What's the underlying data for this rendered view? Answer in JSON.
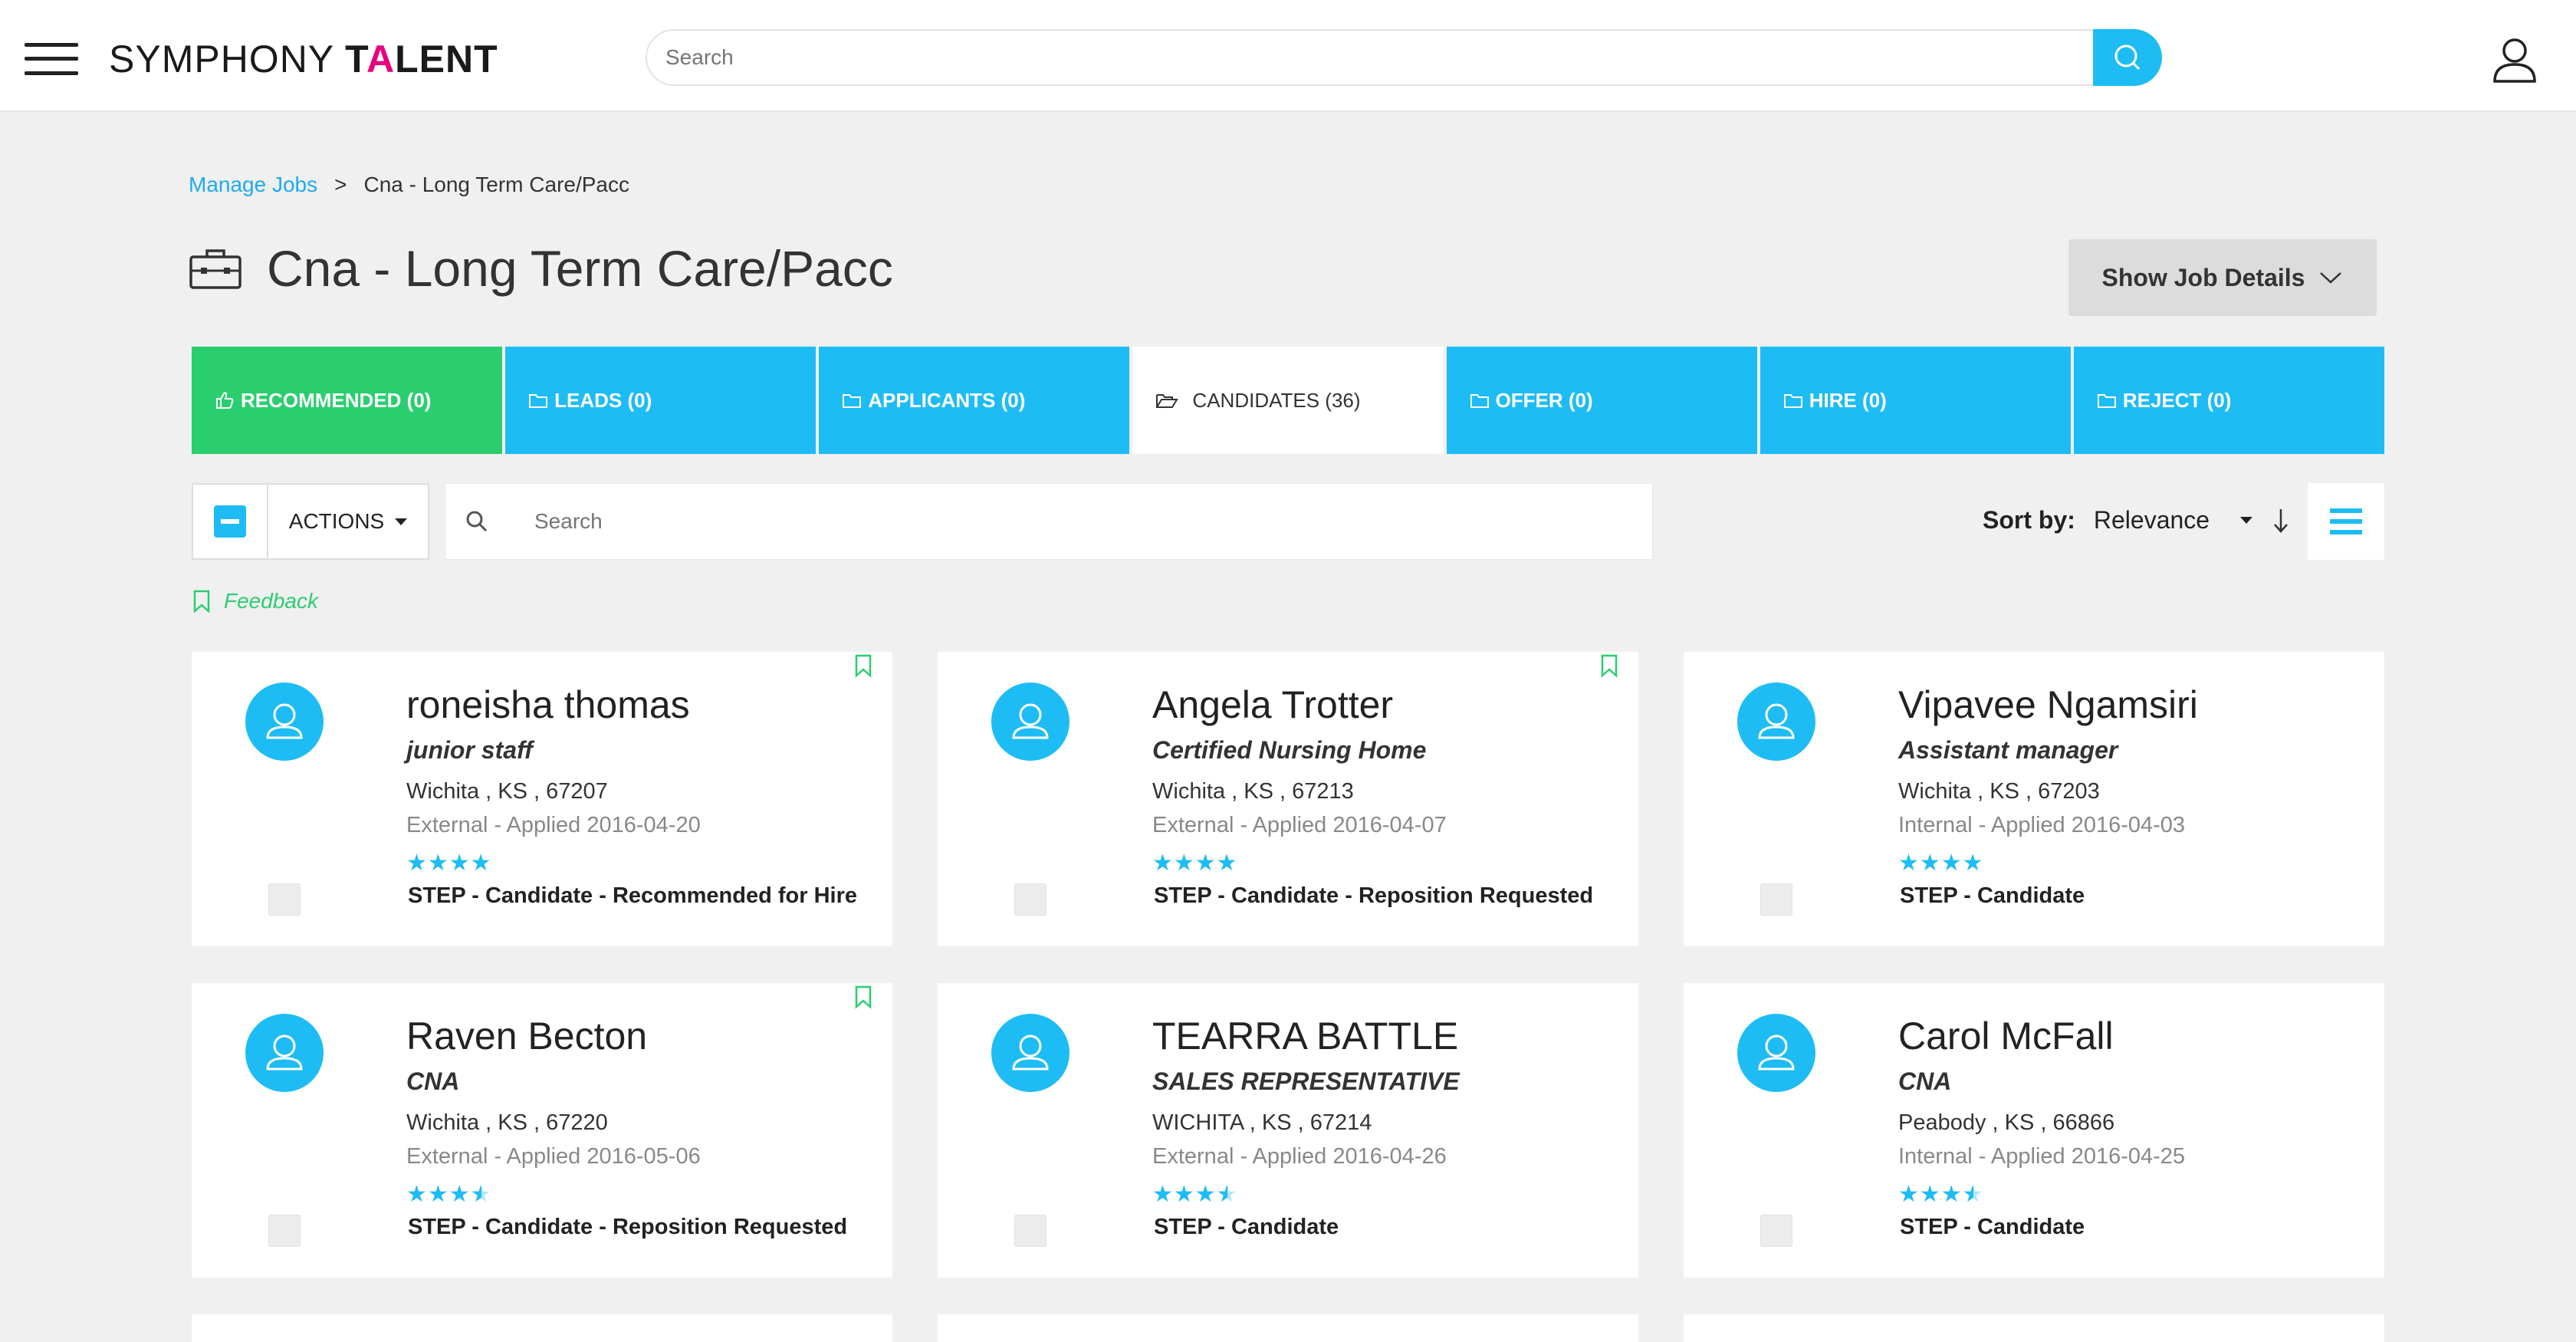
{
  "header": {
    "logo_part1": "SYMPHONY ",
    "logo_part2": "T",
    "logo_accent": "A",
    "logo_part3": "LENT",
    "search_placeholder": "Search"
  },
  "breadcrumb": {
    "root": "Manage Jobs",
    "separator": ">",
    "current": "Cna - Long Term Care/Pacc"
  },
  "page": {
    "title": "Cna - Long Term Care/Pacc",
    "show_details_label": "Show Job Details"
  },
  "tabs": [
    {
      "label": "RECOMMENDED (0)"
    },
    {
      "label": "LEADS (0)"
    },
    {
      "label": "APPLICANTS (0)"
    },
    {
      "label": "CANDIDATES (36)"
    },
    {
      "label": "OFFER (0)"
    },
    {
      "label": "HIRE (0)"
    },
    {
      "label": "REJECT (0)"
    }
  ],
  "toolbar": {
    "actions_label": "ACTIONS",
    "search_placeholder": "Search",
    "sort_label": "Sort by:",
    "sort_value": "Relevance"
  },
  "feedback_label": "Feedback",
  "candidates": [
    {
      "name": "roneisha thomas",
      "role": "junior staff",
      "location": "Wichita , KS , 67207",
      "applied": "External - Applied 2016-04-20",
      "rating": 4,
      "stars": "★★★★",
      "step": "STEP - Candidate - Recommended for Hire",
      "bookmark": true
    },
    {
      "name": "Angela Trotter",
      "role": "Certified Nursing Home",
      "location": "Wichita , KS , 67213",
      "applied": "External - Applied 2016-04-07",
      "rating": 4,
      "stars": "★★★★",
      "step": "STEP - Candidate - Reposition Requested",
      "bookmark": true
    },
    {
      "name": "Vipavee Ngamsiri",
      "role": "Assistant manager",
      "location": "Wichita , KS , 67203",
      "applied": "Internal - Applied 2016-04-03",
      "rating": 4,
      "stars": "★★★★",
      "step": "STEP - Candidate",
      "bookmark": false
    },
    {
      "name": "Raven Becton",
      "role": "CNA",
      "location": "Wichita , KS , 67220",
      "applied": "External - Applied 2016-05-06",
      "rating": 3.5,
      "stars": "★★★",
      "step": "STEP - Candidate - Reposition Requested",
      "bookmark": true
    },
    {
      "name": "TEARRA BATTLE",
      "role": "SALES REPRESENTATIVE",
      "location": "WICHITA , KS , 67214",
      "applied": "External - Applied 2016-04-26",
      "rating": 3.5,
      "stars": "★★★",
      "step": "STEP - Candidate",
      "bookmark": false
    },
    {
      "name": "Carol McFall",
      "role": "CNA",
      "location": "Peabody , KS , 66866",
      "applied": "Internal - Applied 2016-04-25",
      "rating": 3.5,
      "stars": "★★★",
      "step": "STEP - Candidate",
      "bookmark": false
    }
  ],
  "colors": {
    "accent_blue": "#1ebcf4",
    "accent_green": "#2bce6f",
    "logo_pink": "#e6007e"
  }
}
